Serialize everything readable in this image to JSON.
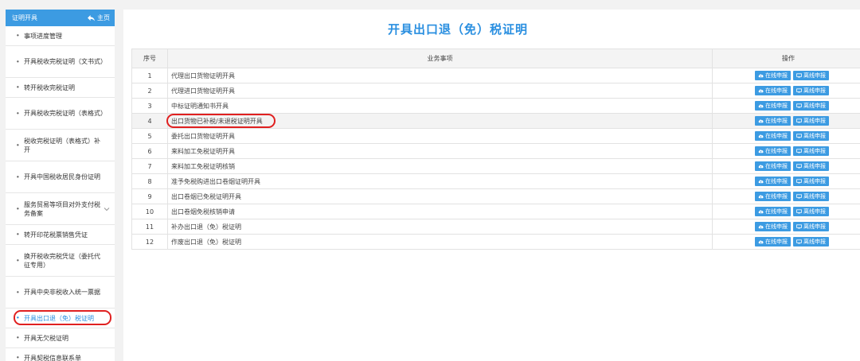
{
  "sidebar": {
    "title": "证明开具",
    "home_label": "主页",
    "items": [
      {
        "label": "事项进度管理"
      },
      {
        "label": "开具税收完税证明（文书式）"
      },
      {
        "label": "转开税收完税证明"
      },
      {
        "label": "开具税收完税证明（表格式）"
      },
      {
        "label": "税收完税证明（表格式）补开"
      },
      {
        "label": "开具中国税收居民身份证明"
      },
      {
        "label": "服务贸易等项目对外支付税务备案"
      },
      {
        "label": "转开印花税票销售凭证"
      },
      {
        "label": "换开税收完税凭证（委托代征专用）"
      },
      {
        "label": "开具中央非税收入统一票据"
      },
      {
        "label": "开具出口退（免）税证明"
      },
      {
        "label": "开具无欠税证明"
      },
      {
        "label": "开具契税信息联系单"
      }
    ]
  },
  "main": {
    "title": "开具出口退（免）税证明",
    "columns": {
      "index": "序号",
      "item": "业务事项",
      "ops": "操作"
    },
    "online_label": "在线申报",
    "offline_label": "离线申报",
    "rows": [
      {
        "index": "1",
        "item": "代理出口货物证明开具"
      },
      {
        "index": "2",
        "item": "代理进口货物证明开具"
      },
      {
        "index": "3",
        "item": "中标证明通知书开具"
      },
      {
        "index": "4",
        "item": "出口货物已补税/未退税证明开具"
      },
      {
        "index": "5",
        "item": "委托出口货物证明开具"
      },
      {
        "index": "6",
        "item": "来料加工免税证明开具"
      },
      {
        "index": "7",
        "item": "来料加工免税证明核销"
      },
      {
        "index": "8",
        "item": "准予免税购进出口卷烟证明开具"
      },
      {
        "index": "9",
        "item": "出口卷烟已免税证明开具"
      },
      {
        "index": "10",
        "item": "出口卷烟免税核销申请"
      },
      {
        "index": "11",
        "item": "补办出口退（免）税证明"
      },
      {
        "index": "12",
        "item": "作废出口退（免）税证明"
      }
    ]
  },
  "colors": {
    "accent": "#3c9be2",
    "highlight_circle": "#e02020"
  },
  "icons": {
    "home": "back-arrow-icon",
    "online": "cloud-upload-icon",
    "offline": "monitor-icon",
    "expand": "chevron-down-icon"
  }
}
